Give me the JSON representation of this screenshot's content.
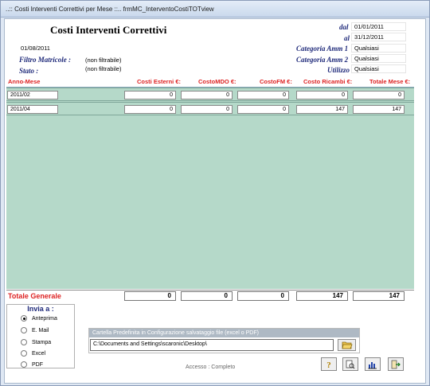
{
  "window": {
    "title": "..:: Costi Interventi Correttivi per Mese ::..  frmMC_InterventoCostiTOTview"
  },
  "header": {
    "title": "Costi Interventi Correttivi",
    "date": "01/08/2011",
    "filtro_matricole_label": "Filtro Matricole :",
    "filtro_matricole_value": "(non filtrabile)",
    "stato_label": "Stato :",
    "stato_value": "(non filtrabile)"
  },
  "params": {
    "dal_label": "dal",
    "dal_value": "01/01/2011",
    "al_label": "al",
    "al_value": "31/12/2011",
    "cat1_label": "Categoria Amm 1",
    "cat1_value": "Qualsiasi",
    "cat2_label": "Categoria Amm 2",
    "cat2_value": "Qualsiasi",
    "utilizzo_label": "Utilizzo",
    "utilizzo_value": "Qualsiasi"
  },
  "columns": {
    "anno_mese": "Anno-Mese",
    "costi_esterni": "Costi Esterni €:",
    "costo_mdo": "CostoMDO €:",
    "costo_fm": "CostoFM €:",
    "costo_ricambi": "Costo Ricambi €:",
    "totale_mese": "Totale Mese €:"
  },
  "rows": [
    {
      "anno_mese": "2011/02",
      "costi_esterni": "0",
      "costo_mdo": "0",
      "costo_fm": "0",
      "costo_ricambi": "0",
      "totale_mese": "0"
    },
    {
      "anno_mese": "2011/04",
      "costi_esterni": "0",
      "costo_mdo": "0",
      "costo_fm": "0",
      "costo_ricambi": "147",
      "totale_mese": "147"
    }
  ],
  "totals": {
    "label": "Totale Generale",
    "costi_esterni": "0",
    "costo_mdo": "0",
    "costo_fm": "0",
    "costo_ricambi": "147",
    "totale_mese": "147"
  },
  "invia": {
    "title": "Invia a :",
    "options": [
      "Anteprima",
      "E. Mail",
      "Stampa",
      "Excel",
      "PDF"
    ],
    "selected": "Anteprima"
  },
  "cartella": {
    "header": "Cartella Predefinita in Configurazione salvataggio file (excel o PDF)",
    "path": "C:\\Documents and Settings\\scaronic\\Desktop\\"
  },
  "footer": {
    "accesso": "Accesso : Completo"
  },
  "icons": {
    "help": "question-icon",
    "preview": "preview-icon",
    "chart": "chart-icon",
    "exit": "exit-icon",
    "folder": "folder-open-icon"
  }
}
